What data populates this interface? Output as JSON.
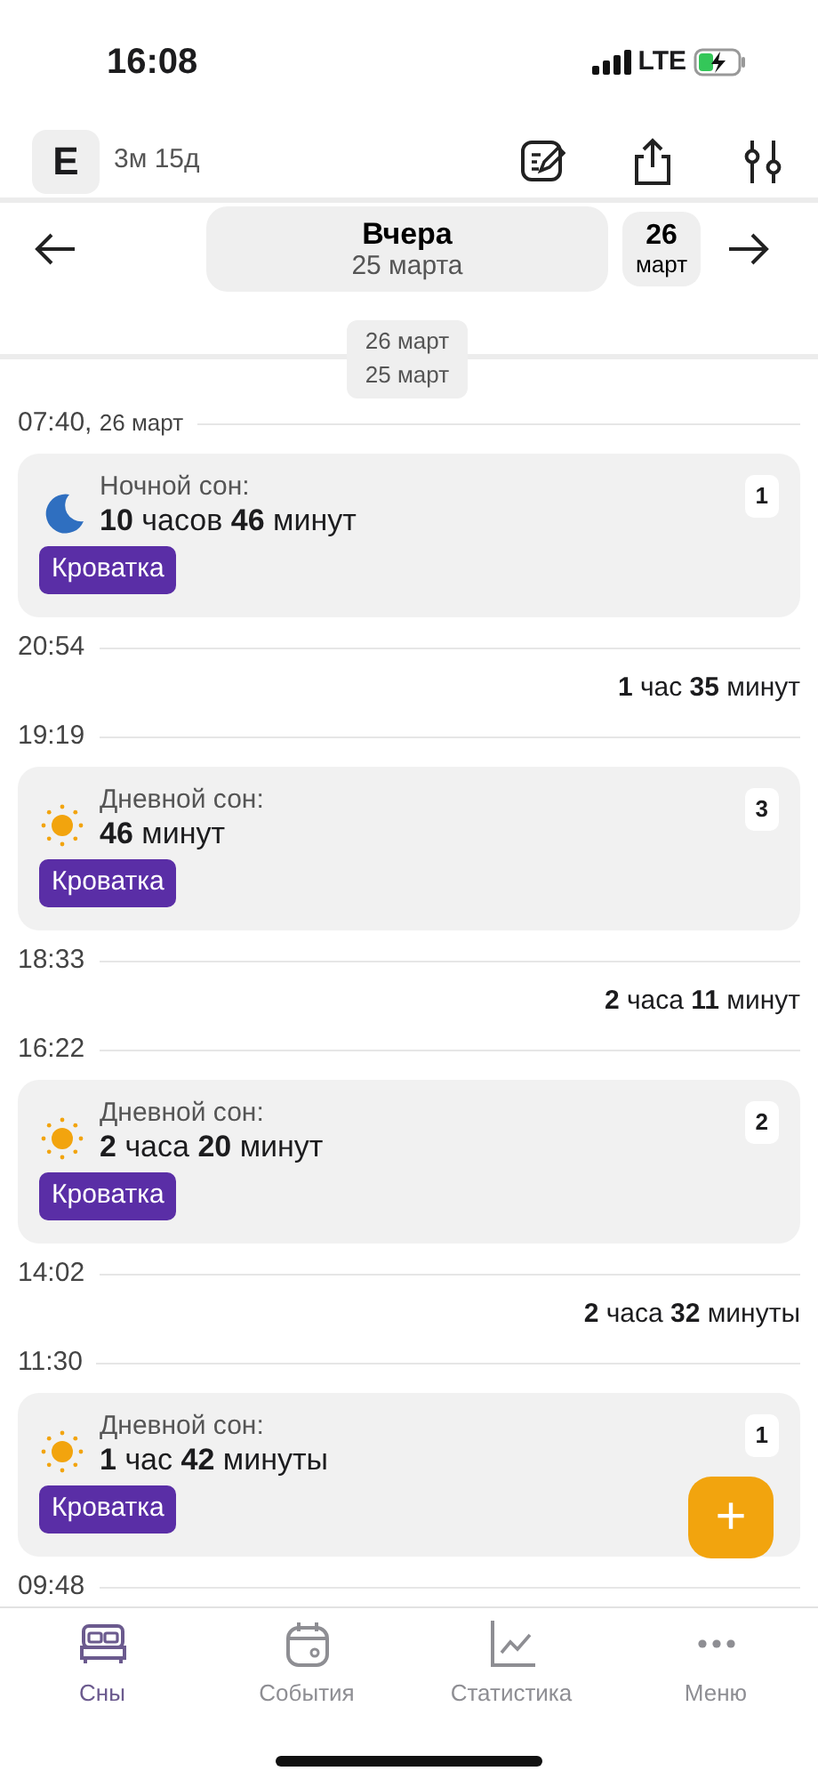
{
  "status_bar": {
    "time": "16:08",
    "network": "LTE"
  },
  "header": {
    "avatar": "E",
    "age": "3м 15д"
  },
  "date_nav": {
    "title": "Вчера",
    "date": "25 марта",
    "next_day": "26",
    "next_month": "март"
  },
  "sticky_dates": [
    "26 март",
    "25 март"
  ],
  "timeline": [
    {
      "kind": "time",
      "time": "07:40,",
      "date": "26 март"
    },
    {
      "kind": "sleep",
      "night": true,
      "label": "Ночной сон:",
      "duration": "**10** часов **46** минут",
      "tag": "Кроватка",
      "count": "1"
    },
    {
      "kind": "time",
      "time": "20:54"
    },
    {
      "kind": "gap",
      "duration": "**1** час **35** минут"
    },
    {
      "kind": "time",
      "time": "19:19"
    },
    {
      "kind": "sleep",
      "night": false,
      "label": "Дневной сон:",
      "duration": "**46** минут",
      "tag": "Кроватка",
      "count": "3"
    },
    {
      "kind": "time",
      "time": "18:33"
    },
    {
      "kind": "gap",
      "duration": "**2** часа **11** минут"
    },
    {
      "kind": "time",
      "time": "16:22"
    },
    {
      "kind": "sleep",
      "night": false,
      "label": "Дневной сон:",
      "duration": "**2** часа **20** минут",
      "tag": "Кроватка",
      "count": "2"
    },
    {
      "kind": "time",
      "time": "14:02"
    },
    {
      "kind": "gap",
      "duration": "**2** часа **32** минуты"
    },
    {
      "kind": "time",
      "time": "11:30"
    },
    {
      "kind": "sleep",
      "night": false,
      "label": "Дневной сон:",
      "duration": "**1** час **42** минуты",
      "tag": "Кроватка",
      "count": "1"
    },
    {
      "kind": "time",
      "time": "09:48"
    }
  ],
  "fab": {
    "label": "+"
  },
  "tabs": [
    {
      "kind": "sleep",
      "label": "Сны",
      "selected": true
    },
    {
      "kind": "events",
      "label": "События",
      "selected": false
    },
    {
      "kind": "stats",
      "label": "Статистика",
      "selected": false
    },
    {
      "kind": "menu",
      "label": "Меню",
      "selected": false
    }
  ]
}
